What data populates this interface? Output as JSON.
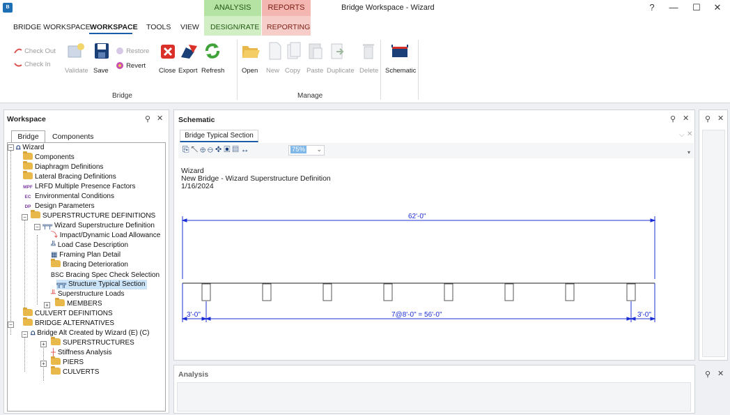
{
  "window": {
    "title": "Bridge Workspace - Wizard",
    "help": "?",
    "minimize": "—",
    "maximize": "☐",
    "close": "✕"
  },
  "context_tabs": {
    "analysis_header": "ANALYSIS",
    "reports_header": "REPORTS"
  },
  "tabs": {
    "bridge_workspace": "BRIDGE WORKSPACE",
    "workspace": "WORKSPACE",
    "tools": "TOOLS",
    "view": "VIEW",
    "design_rate": "DESIGN/RATE",
    "reporting": "REPORTING"
  },
  "ribbon": {
    "check_out": "Check Out",
    "check_in": "Check In",
    "validate": "Validate",
    "save": "Save",
    "restore": "Restore",
    "revert": "Revert",
    "close": "Close",
    "export": "Export",
    "refresh": "Refresh",
    "group_bridge": "Bridge",
    "open": "Open",
    "new": "New",
    "copy": "Copy",
    "paste": "Paste",
    "duplicate": "Duplicate",
    "delete": "Delete",
    "group_manage": "Manage",
    "schematic": "Schematic"
  },
  "workspace_pane": {
    "title": "Workspace",
    "tab_bridge": "Bridge",
    "tab_components": "Components",
    "tree": {
      "wizard": "Wizard",
      "components": "Components",
      "diaphragm": "Diaphragm Definitions",
      "lateral_bracing": "Lateral Bracing Definitions",
      "lrfd_tag": "MPF",
      "lrfd": "LRFD Multiple Presence Factors",
      "env_tag": "EC",
      "env": "Environmental Conditions",
      "dp_tag": "DP",
      "dp": "Design Parameters",
      "superstructure_defs": "SUPERSTRUCTURE DEFINITIONS",
      "wizard_super": "Wizard Superstructure Definition",
      "impact": "Impact/Dynamic Load Allowance",
      "load_case": "Load Case Description",
      "framing": "Framing Plan Detail",
      "bracing_det": "Bracing Deterioration",
      "bsc_tag": "BSC",
      "bracing_spec": "Bracing Spec Check Selection",
      "typical_section": "Structure Typical Section",
      "super_loads": "Superstructure Loads",
      "members": "MEMBERS",
      "culvert_defs": "CULVERT DEFINITIONS",
      "bridge_alts": "BRIDGE ALTERNATIVES",
      "bridge_alt": "Bridge Alt Created by Wizard (E) (C)",
      "superstructures": "SUPERSTRUCTURES",
      "stiffness": "Stiffness Analysis",
      "piers": "PIERS",
      "culverts": "CULVERTS"
    }
  },
  "schematic_pane": {
    "title": "Schematic",
    "doc_tab": "Bridge Typical Section",
    "zoom": "75%",
    "heading_line1": "Wizard",
    "heading_line2": "New Bridge - Wizard Superstructure Definition",
    "heading_line3": "1/16/2024",
    "dim_total": "62'-0\"",
    "dim_left": "3'-0\"",
    "dim_middle": "7@8'-0\" = 56'-0\"",
    "dim_right": "3'-0\""
  },
  "analysis_pane": {
    "title": "Analysis"
  },
  "colors": {
    "analysis_ctx": "#b4e3a3",
    "reports_ctx": "#f3b6b0",
    "selection": "#cce4f7",
    "dimension_blue": "#1c2fd6"
  }
}
